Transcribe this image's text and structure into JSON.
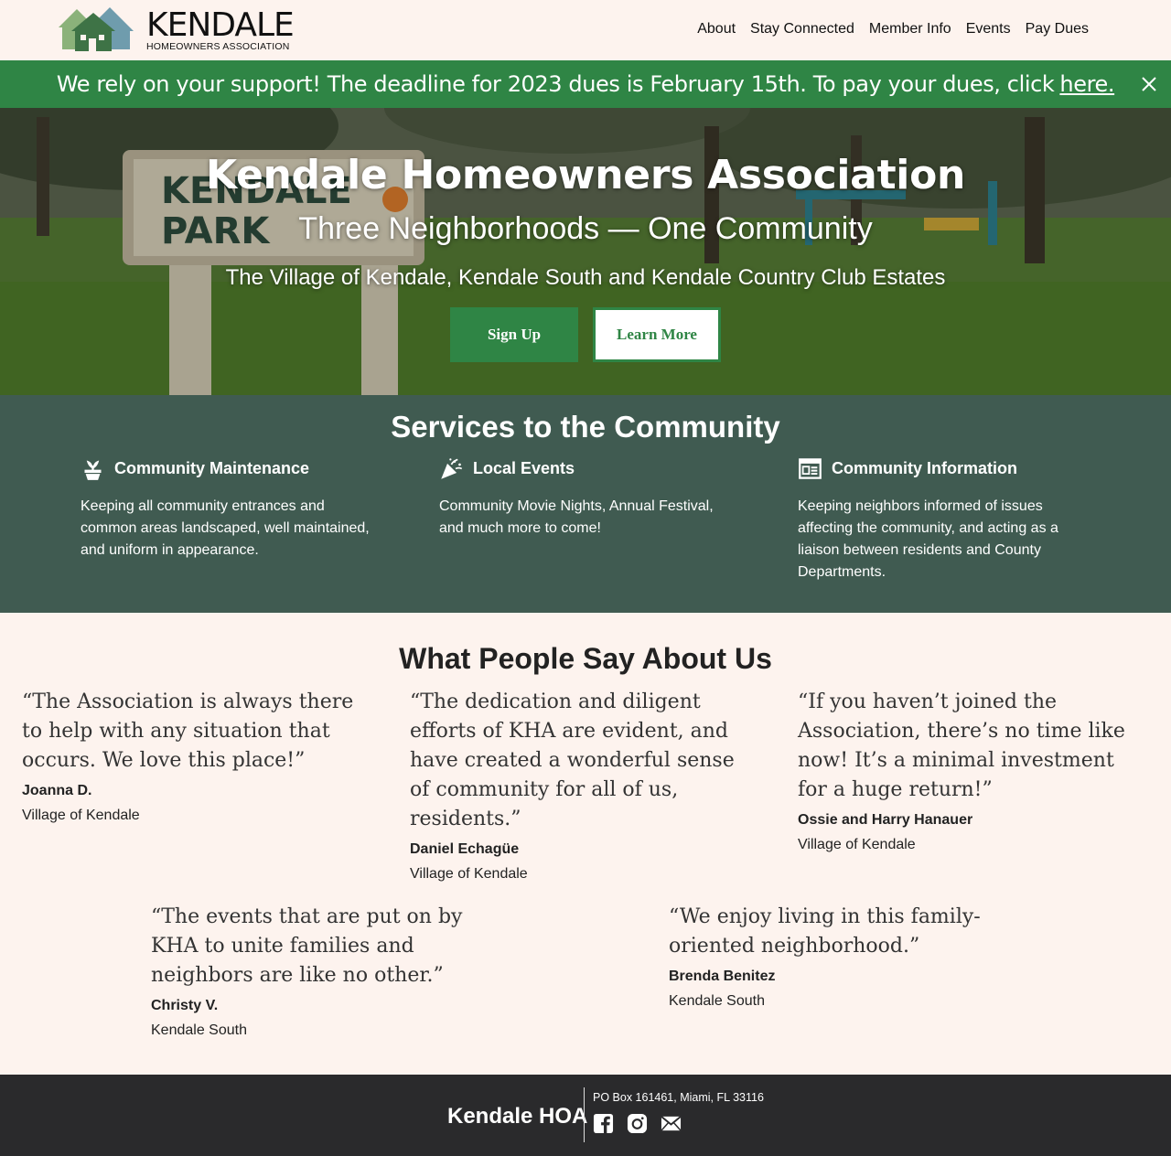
{
  "header": {
    "logo_name": "KENDALE",
    "logo_sub": "HOMEOWNERS ASSOCIATION",
    "nav": [
      "About",
      "Stay Connected",
      "Member Info",
      "Events",
      "Pay Dues"
    ]
  },
  "banner": {
    "text": "We rely on your support! The deadline for 2023 dues is February 15th. To pay your dues, click",
    "link": "here."
  },
  "hero": {
    "sign_line1": "KENDALE",
    "sign_line2": "PARK",
    "title": "Kendale Homeowners Association",
    "subtitle": "Three Neighborhoods — One Community",
    "description": "The Village of Kendale, Kendale South and Kendale Country Club Estates",
    "primary_button": "Sign Up",
    "secondary_button": "Learn More"
  },
  "services": {
    "title": "Services to the Community",
    "items": [
      {
        "icon": "potted-plant-icon",
        "title": "Community Maintenance",
        "text": "Keeping all community entrances and common areas landscaped, well maintained, and uniform in appearance."
      },
      {
        "icon": "party-popper-icon",
        "title": "Local Events",
        "text": "Community Movie Nights, Annual Festival, and much more to come!"
      },
      {
        "icon": "newspaper-icon",
        "title": "Community Information",
        "text": "Keeping neighbors informed of issues affecting the community, and acting as a liaison between residents and County Departments."
      }
    ]
  },
  "testimonials": {
    "title": "What People Say About Us",
    "items": [
      {
        "quote": "“The Association is always there to help with any situation that occurs. We love this place!”",
        "name": "Joanna D.",
        "place": "Village of Kendale"
      },
      {
        "quote": "“The dedication and diligent efforts of KHA are evident, and have created a wonderful sense of community for all of us, residents.”",
        "name": "Daniel Echagüe",
        "place": "Village of Kendale"
      },
      {
        "quote": "“If you haven’t joined the Association, there’s no time like now! It’s a minimal investment for a huge return!”",
        "name": "Ossie and Harry Hanauer",
        "place": "Village of Kendale"
      },
      {
        "quote": "“The events that are put on by KHA to unite families and neighbors are like no other.”",
        "name": "Christy V.",
        "place": "Kendale South"
      },
      {
        "quote": "“We enjoy living in this family-oriented neighborhood.”",
        "name": "Brenda Benitez",
        "place": "Kendale South"
      }
    ]
  },
  "footer": {
    "brand": "Kendale HOA",
    "address": "PO Box 161461, Miami, FL 33116",
    "social": [
      "facebook-icon",
      "instagram-icon",
      "email-icon"
    ]
  },
  "colors": {
    "brand_green": "#2f8545",
    "services_bg": "#405b51",
    "page_bg": "#fdf3ee",
    "footer_bg": "#2a2a2c"
  }
}
